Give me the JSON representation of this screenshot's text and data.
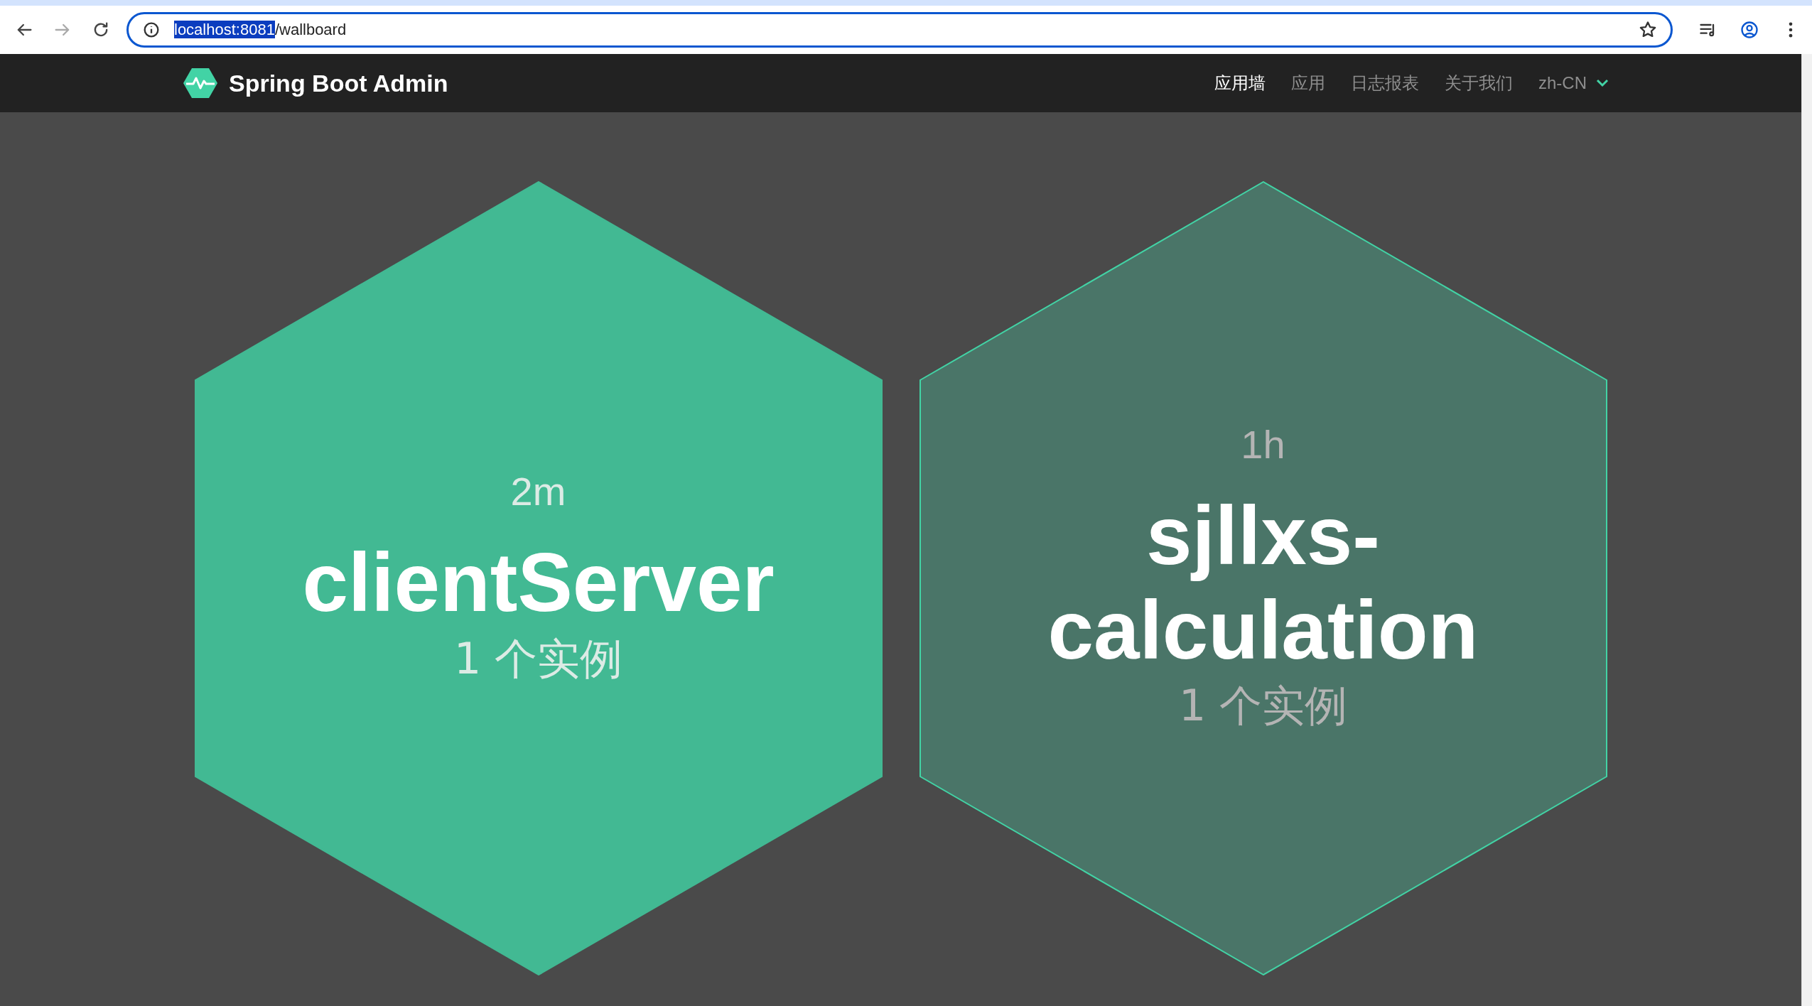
{
  "browser": {
    "url_host": "localhost:8081",
    "url_path": "/wallboard"
  },
  "navbar": {
    "brand": "Spring Boot Admin",
    "items": [
      {
        "label": "应用墙",
        "selected": true
      },
      {
        "label": "应用",
        "selected": false
      },
      {
        "label": "日志报表",
        "selected": false
      },
      {
        "label": "关于我们",
        "selected": false
      }
    ],
    "language": "zh-CN"
  },
  "applications": [
    {
      "uptime": "2m",
      "name": "clientServer",
      "instances": "1 个实例",
      "up": true
    },
    {
      "uptime": "1h",
      "name": "sjllxs-calculation",
      "instances": "1 个实例",
      "up": false
    }
  ]
}
